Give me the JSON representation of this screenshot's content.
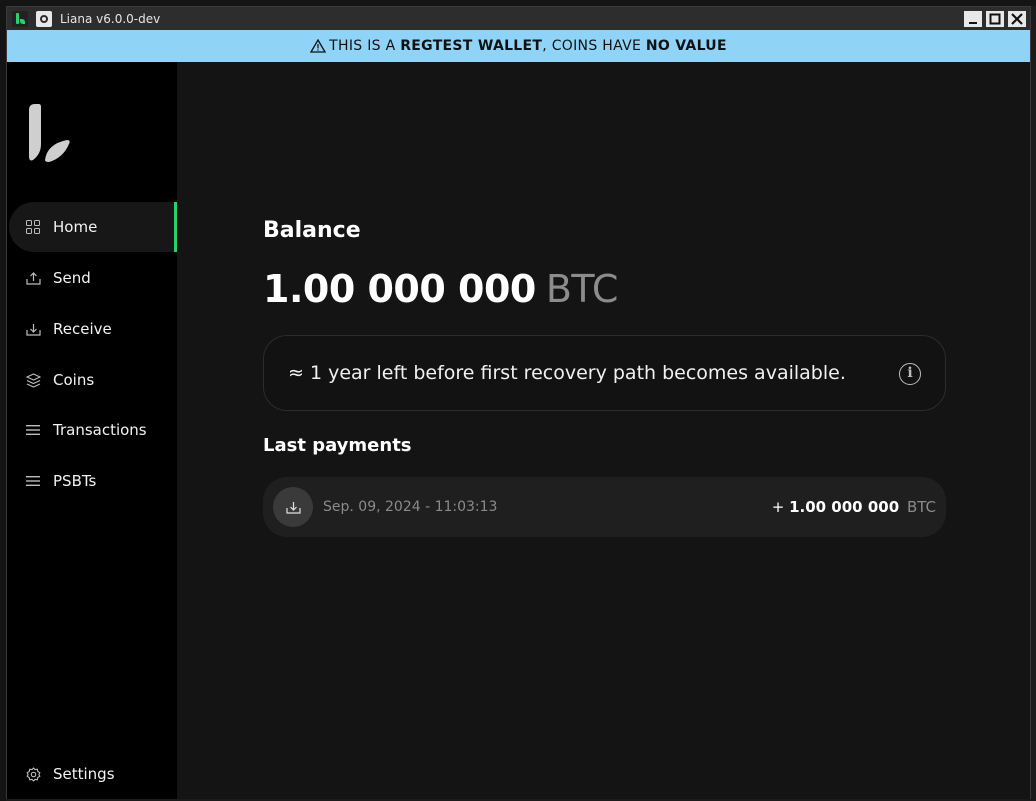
{
  "window": {
    "title": "Liana v6.0.0-dev",
    "controls": {
      "minimize": "_",
      "maximize": "□",
      "close": "✕"
    }
  },
  "banner": {
    "prefix": "THIS IS A ",
    "highlight1": "REGTEST WALLET",
    "middle": ", COINS HAVE ",
    "highlight2": "NO VALUE"
  },
  "sidebar": {
    "items": [
      {
        "label": "Home",
        "icon": "grid-icon"
      },
      {
        "label": "Send",
        "icon": "send-icon"
      },
      {
        "label": "Receive",
        "icon": "receive-icon"
      },
      {
        "label": "Coins",
        "icon": "coins-icon"
      },
      {
        "label": "Transactions",
        "icon": "list-icon"
      },
      {
        "label": "PSBTs",
        "icon": "list-icon"
      }
    ],
    "settings": {
      "label": "Settings",
      "icon": "gear-icon"
    }
  },
  "main": {
    "balance_title": "Balance",
    "balance_amount": "1.00 000 000",
    "balance_unit": "BTC",
    "recovery_notice": "≈ 1 year left before first recovery path becomes available.",
    "last_payments_title": "Last payments",
    "payments": [
      {
        "date": "Sep. 09, 2024 - 11:03:13",
        "sign": "+",
        "amount": "1.00 000 000",
        "unit": "BTC"
      }
    ]
  },
  "colors": {
    "banner_bg": "#8fd3f6",
    "accent": "#29d06b",
    "sidebar_bg": "#000000",
    "main_bg": "#141414"
  }
}
